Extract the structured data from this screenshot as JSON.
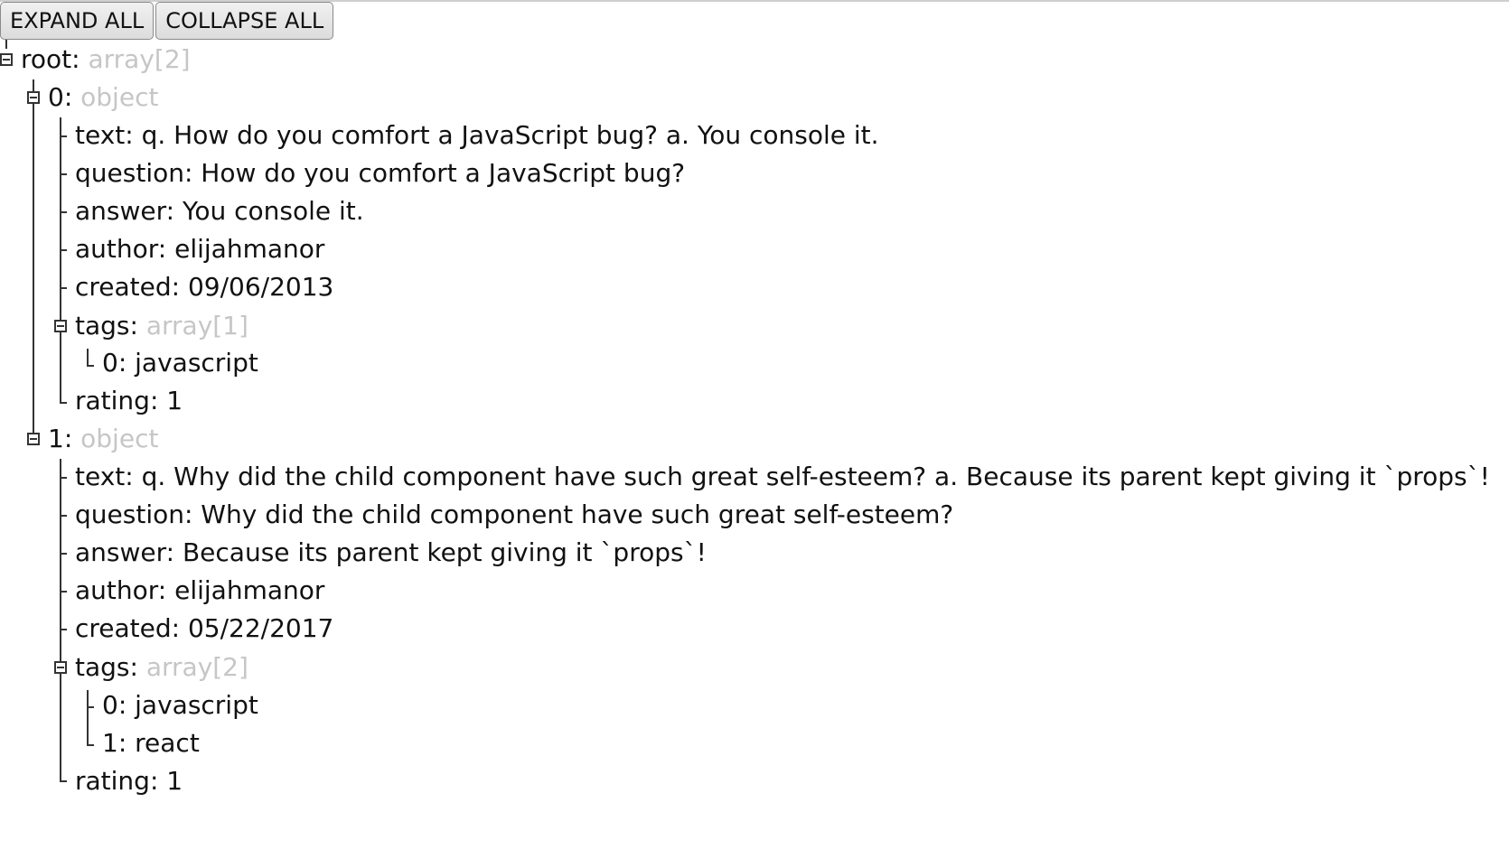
{
  "toolbar": {
    "expand_label": "EXPAND ALL",
    "collapse_label": "COLLAPSE ALL"
  },
  "tree": {
    "root": {
      "key": "root: ",
      "type": "array[2]"
    },
    "items": [
      {
        "key": "0: ",
        "type": "object",
        "text": "text: q. How do you comfort a JavaScript bug? a. You console it.",
        "question": "question: How do you comfort a JavaScript bug?",
        "answer": "answer: You console it.",
        "author": "author: elijahmanor",
        "created": "created: 09/06/2013",
        "tags_key": "tags: ",
        "tags_type": "array[1]",
        "tags": [
          "0: javascript"
        ],
        "rating": "rating: 1"
      },
      {
        "key": "1: ",
        "type": "object",
        "text": "text: q. Why did the child component have such great self-esteem? a. Because its parent kept giving it `props`!",
        "question": "question: Why did the child component have such great self-esteem?",
        "answer": "answer: Because its parent kept giving it `props`!",
        "author": "author: elijahmanor",
        "created": "created: 05/22/2017",
        "tags_key": "tags: ",
        "tags_type": "array[2]",
        "tags": [
          "0: javascript",
          "1: react"
        ],
        "rating": "rating: 1"
      }
    ]
  }
}
